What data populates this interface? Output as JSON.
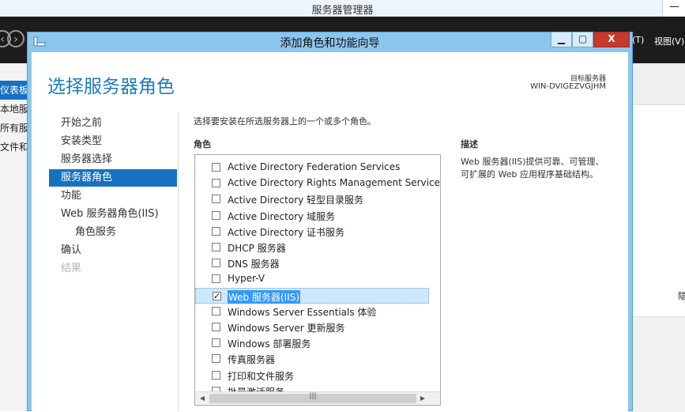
{
  "background_window": {
    "title": "服务器管理器",
    "minimize_glyph": "—",
    "menu_items": [
      "(T)",
      "视图(V)"
    ],
    "left_items": [
      "仪表板",
      "本地服",
      "所有服",
      "文件和"
    ],
    "right_fragment": "隐"
  },
  "dialog": {
    "title": "添加角色和功能向导",
    "close_glyph": "X",
    "page_title": "选择服务器角色",
    "target_label": "目标服务器",
    "target_server": "WIN-DVIGEZVGJHM",
    "nav": [
      {
        "label": "开始之前",
        "state": "normal"
      },
      {
        "label": "安装类型",
        "state": "normal"
      },
      {
        "label": "服务器选择",
        "state": "normal"
      },
      {
        "label": "服务器角色",
        "state": "active"
      },
      {
        "label": "功能",
        "state": "normal"
      },
      {
        "label": "Web 服务器角色(IIS)",
        "state": "normal"
      },
      {
        "label": "角色服务",
        "state": "sub"
      },
      {
        "label": "确认",
        "state": "normal"
      },
      {
        "label": "结果",
        "state": "disabled"
      }
    ],
    "instruction": "选择要安装在所选服务器上的一个或多个角色。",
    "roles_heading": "角色",
    "roles": [
      {
        "label": "Active Directory Federation Services",
        "checked": false
      },
      {
        "label": "Active Directory Rights Management Services",
        "checked": false
      },
      {
        "label": "Active Directory 轻型目录服务",
        "checked": false
      },
      {
        "label": "Active Directory 域服务",
        "checked": false
      },
      {
        "label": "Active Directory 证书服务",
        "checked": false
      },
      {
        "label": "DHCP 服务器",
        "checked": false
      },
      {
        "label": "DNS 服务器",
        "checked": false
      },
      {
        "label": "Hyper-V",
        "checked": false
      },
      {
        "label": "Web 服务器(IIS)",
        "checked": true,
        "selected": true
      },
      {
        "label": "Windows Server Essentials 体验",
        "checked": false
      },
      {
        "label": "Windows Server 更新服务",
        "checked": false
      },
      {
        "label": "Windows 部署服务",
        "checked": false
      },
      {
        "label": "传真服务器",
        "checked": false
      },
      {
        "label": "打印和文件服务",
        "checked": false
      },
      {
        "label": "批量激活服务",
        "checked": false
      }
    ],
    "description_heading": "描述",
    "description": "Web 服务器(IIS)提供可靠、可管理、可扩展的 Web 应用程序基础结构。",
    "check_glyph": "✓",
    "scroll_grip_v": "≡",
    "scroll_grip_h": "|||"
  },
  "colors": {
    "accent": "#1672c0",
    "title_blue": "#1d7bbd",
    "dialog_frame": "#8cc6ec",
    "close_red": "#c43a2e",
    "selection_highlight": "#3399ff"
  }
}
